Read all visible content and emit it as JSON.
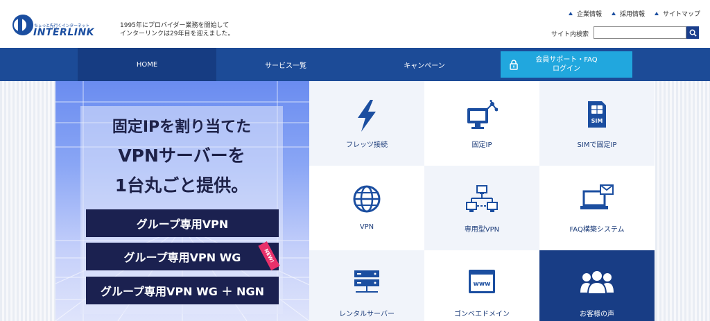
{
  "header": {
    "logo_tagline": "ちょっと先行くインターネット",
    "logo_wordmark": "INTERLINK",
    "desc_line1": "1995年にプロバイダー業務を開始して",
    "desc_line2": "インターリンクは29年目を迎えました。",
    "top_links": [
      "企業情報",
      "採用情報",
      "サイトマップ"
    ],
    "search_label": "サイト内検索",
    "search_value": ""
  },
  "nav": {
    "home": "HOME",
    "services": "サービス一覧",
    "campaign": "キャンペーン",
    "support_line1": "会員サポート・FAQ",
    "support_line2": "ログイン"
  },
  "hero": {
    "line1": "固定IPを割り当てた",
    "line2": "VPNサーバーを",
    "line3": "1台丸ごと提供。",
    "buttons": [
      "グループ専用VPN",
      "グループ専用VPN WG",
      "グループ専用VPN WG ＋ NGN"
    ],
    "badge": "NEW!"
  },
  "services": [
    {
      "label": "フレッツ接続",
      "icon": "lightning-icon"
    },
    {
      "label": "固定IP",
      "icon": "monitor-network-icon"
    },
    {
      "label": "SIMで固定IP",
      "icon": "sim-card-icon"
    },
    {
      "label": "VPN",
      "icon": "globe-icon"
    },
    {
      "label": "専用型VPN",
      "icon": "network-topology-icon"
    },
    {
      "label": "FAQ構築システム",
      "icon": "laptop-mail-icon"
    },
    {
      "label": "レンタルサーバー",
      "icon": "server-icon"
    },
    {
      "label": "ゴンベエドメイン",
      "icon": "browser-www-icon"
    },
    {
      "label": "お客様の声",
      "icon": "people-icon"
    }
  ],
  "colors": {
    "brand": "#1b4ea0",
    "nav_bg": "#1c4b97",
    "nav_active": "#163c82",
    "support_accent": "#21a7de",
    "hero_button": "#1b2150",
    "badge": "#e8306a"
  }
}
